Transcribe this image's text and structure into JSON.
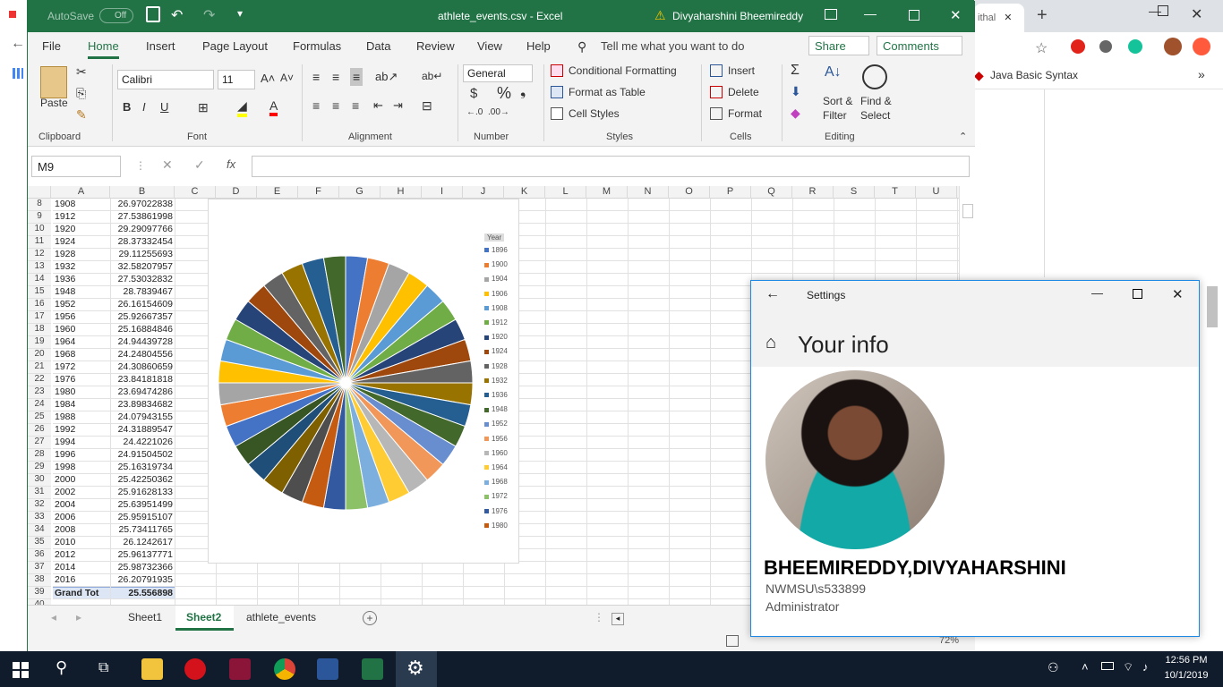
{
  "browser": {
    "tab_fragment": "ithal",
    "bookmark": "Java Basic Syntax"
  },
  "excel": {
    "autosave_label": "AutoSave",
    "autosave_state": "Off",
    "file_title": "athlete_events.csv  -  Excel",
    "user": "Divyaharshini Bheemireddy",
    "tabs": [
      "File",
      "Home",
      "Insert",
      "Page Layout",
      "Formulas",
      "Data",
      "Review",
      "View",
      "Help"
    ],
    "tell_me": "Tell me what you want to do",
    "share": "Share",
    "comments": "Comments",
    "clipboard": {
      "paste": "Paste",
      "label": "Clipboard"
    },
    "font": {
      "name": "Calibri",
      "size": "11",
      "label": "Font"
    },
    "alignment_label": "Alignment",
    "number": {
      "format": "General",
      "label": "Number"
    },
    "styles": {
      "conditional": "Conditional Formatting",
      "table": "Format as Table",
      "cell": "Cell Styles",
      "label": "Styles"
    },
    "cells": {
      "insert": "Insert",
      "delete": "Delete",
      "format": "Format",
      "label": "Cells"
    },
    "editing": {
      "sort": "Sort &",
      "sort2": "Filter",
      "find": "Find &",
      "find2": "Select",
      "label": "Editing"
    },
    "namebox": "M9",
    "columns": [
      "A",
      "B",
      "C",
      "D",
      "E",
      "F",
      "G",
      "H",
      "I",
      "J",
      "K",
      "L",
      "M",
      "N",
      "O",
      "P",
      "Q",
      "R",
      "S",
      "T",
      "U"
    ],
    "rows": [
      {
        "n": "8",
        "a": "1908",
        "b": "26.97022838"
      },
      {
        "n": "9",
        "a": "1912",
        "b": "27.53861998"
      },
      {
        "n": "10",
        "a": "1920",
        "b": "29.29097766"
      },
      {
        "n": "11",
        "a": "1924",
        "b": "28.37332454"
      },
      {
        "n": "12",
        "a": "1928",
        "b": "29.11255693"
      },
      {
        "n": "13",
        "a": "1932",
        "b": "32.58207957"
      },
      {
        "n": "14",
        "a": "1936",
        "b": "27.53032832"
      },
      {
        "n": "15",
        "a": "1948",
        "b": "28.7839467"
      },
      {
        "n": "16",
        "a": "1952",
        "b": "26.16154609"
      },
      {
        "n": "17",
        "a": "1956",
        "b": "25.92667357"
      },
      {
        "n": "18",
        "a": "1960",
        "b": "25.16884846"
      },
      {
        "n": "19",
        "a": "1964",
        "b": "24.94439728"
      },
      {
        "n": "20",
        "a": "1968",
        "b": "24.24804556"
      },
      {
        "n": "21",
        "a": "1972",
        "b": "24.30860659"
      },
      {
        "n": "22",
        "a": "1976",
        "b": "23.84181818"
      },
      {
        "n": "23",
        "a": "1980",
        "b": "23.69474286"
      },
      {
        "n": "24",
        "a": "1984",
        "b": "23.89834682"
      },
      {
        "n": "25",
        "a": "1988",
        "b": "24.07943155"
      },
      {
        "n": "26",
        "a": "1992",
        "b": "24.31889547"
      },
      {
        "n": "27",
        "a": "1994",
        "b": "24.4221026"
      },
      {
        "n": "28",
        "a": "1996",
        "b": "24.91504502"
      },
      {
        "n": "29",
        "a": "1998",
        "b": "25.16319734"
      },
      {
        "n": "30",
        "a": "2000",
        "b": "25.42250362"
      },
      {
        "n": "31",
        "a": "2002",
        "b": "25.91628133"
      },
      {
        "n": "32",
        "a": "2004",
        "b": "25.63951499"
      },
      {
        "n": "33",
        "a": "2006",
        "b": "25.95915107"
      },
      {
        "n": "34",
        "a": "2008",
        "b": "25.73411765"
      },
      {
        "n": "35",
        "a": "2010",
        "b": "26.1242617"
      },
      {
        "n": "36",
        "a": "2012",
        "b": "25.96137771"
      },
      {
        "n": "37",
        "a": "2014",
        "b": "25.98732366"
      },
      {
        "n": "38",
        "a": "2016",
        "b": "26.20791935"
      },
      {
        "n": "39",
        "a": "Grand Tot",
        "b": "25.556898"
      },
      {
        "n": "40",
        "a": "",
        "b": ""
      }
    ],
    "sheets": [
      "Sheet1",
      "Sheet2",
      "athlete_events"
    ],
    "active_sheet": "Sheet2",
    "zoom": "72%"
  },
  "chart_data": {
    "type": "pie",
    "legend_title": "Year",
    "legend": [
      "1896",
      "1900",
      "1904",
      "1906",
      "1908",
      "1912",
      "1920",
      "1924",
      "1928",
      "1932",
      "1936",
      "1948",
      "1952",
      "1956",
      "1960",
      "1964",
      "1968",
      "1972",
      "1976",
      "1980"
    ],
    "colors": [
      "#4472c4",
      "#ed7d31",
      "#a5a5a5",
      "#ffc000",
      "#5b9bd5",
      "#70ad47",
      "#264478",
      "#9e480e",
      "#636363",
      "#997300",
      "#255e91",
      "#43682b",
      "#698ed0",
      "#f1975a",
      "#b7b7b7",
      "#ffcd33",
      "#7cafdd",
      "#8cc168",
      "#335aa1",
      "#c55a11",
      "#4e4e4e",
      "#7f6000",
      "#1f4e79",
      "#375623"
    ],
    "slices": 36
  },
  "settings": {
    "title": "Settings",
    "heading": "Your info",
    "name": "BHEEMIREDDY,DIVYAHARSHINI",
    "account": "NWMSU\\s533899",
    "role": "Administrator"
  },
  "taskbar": {
    "time": "12:56 PM",
    "date": "10/1/2019"
  }
}
